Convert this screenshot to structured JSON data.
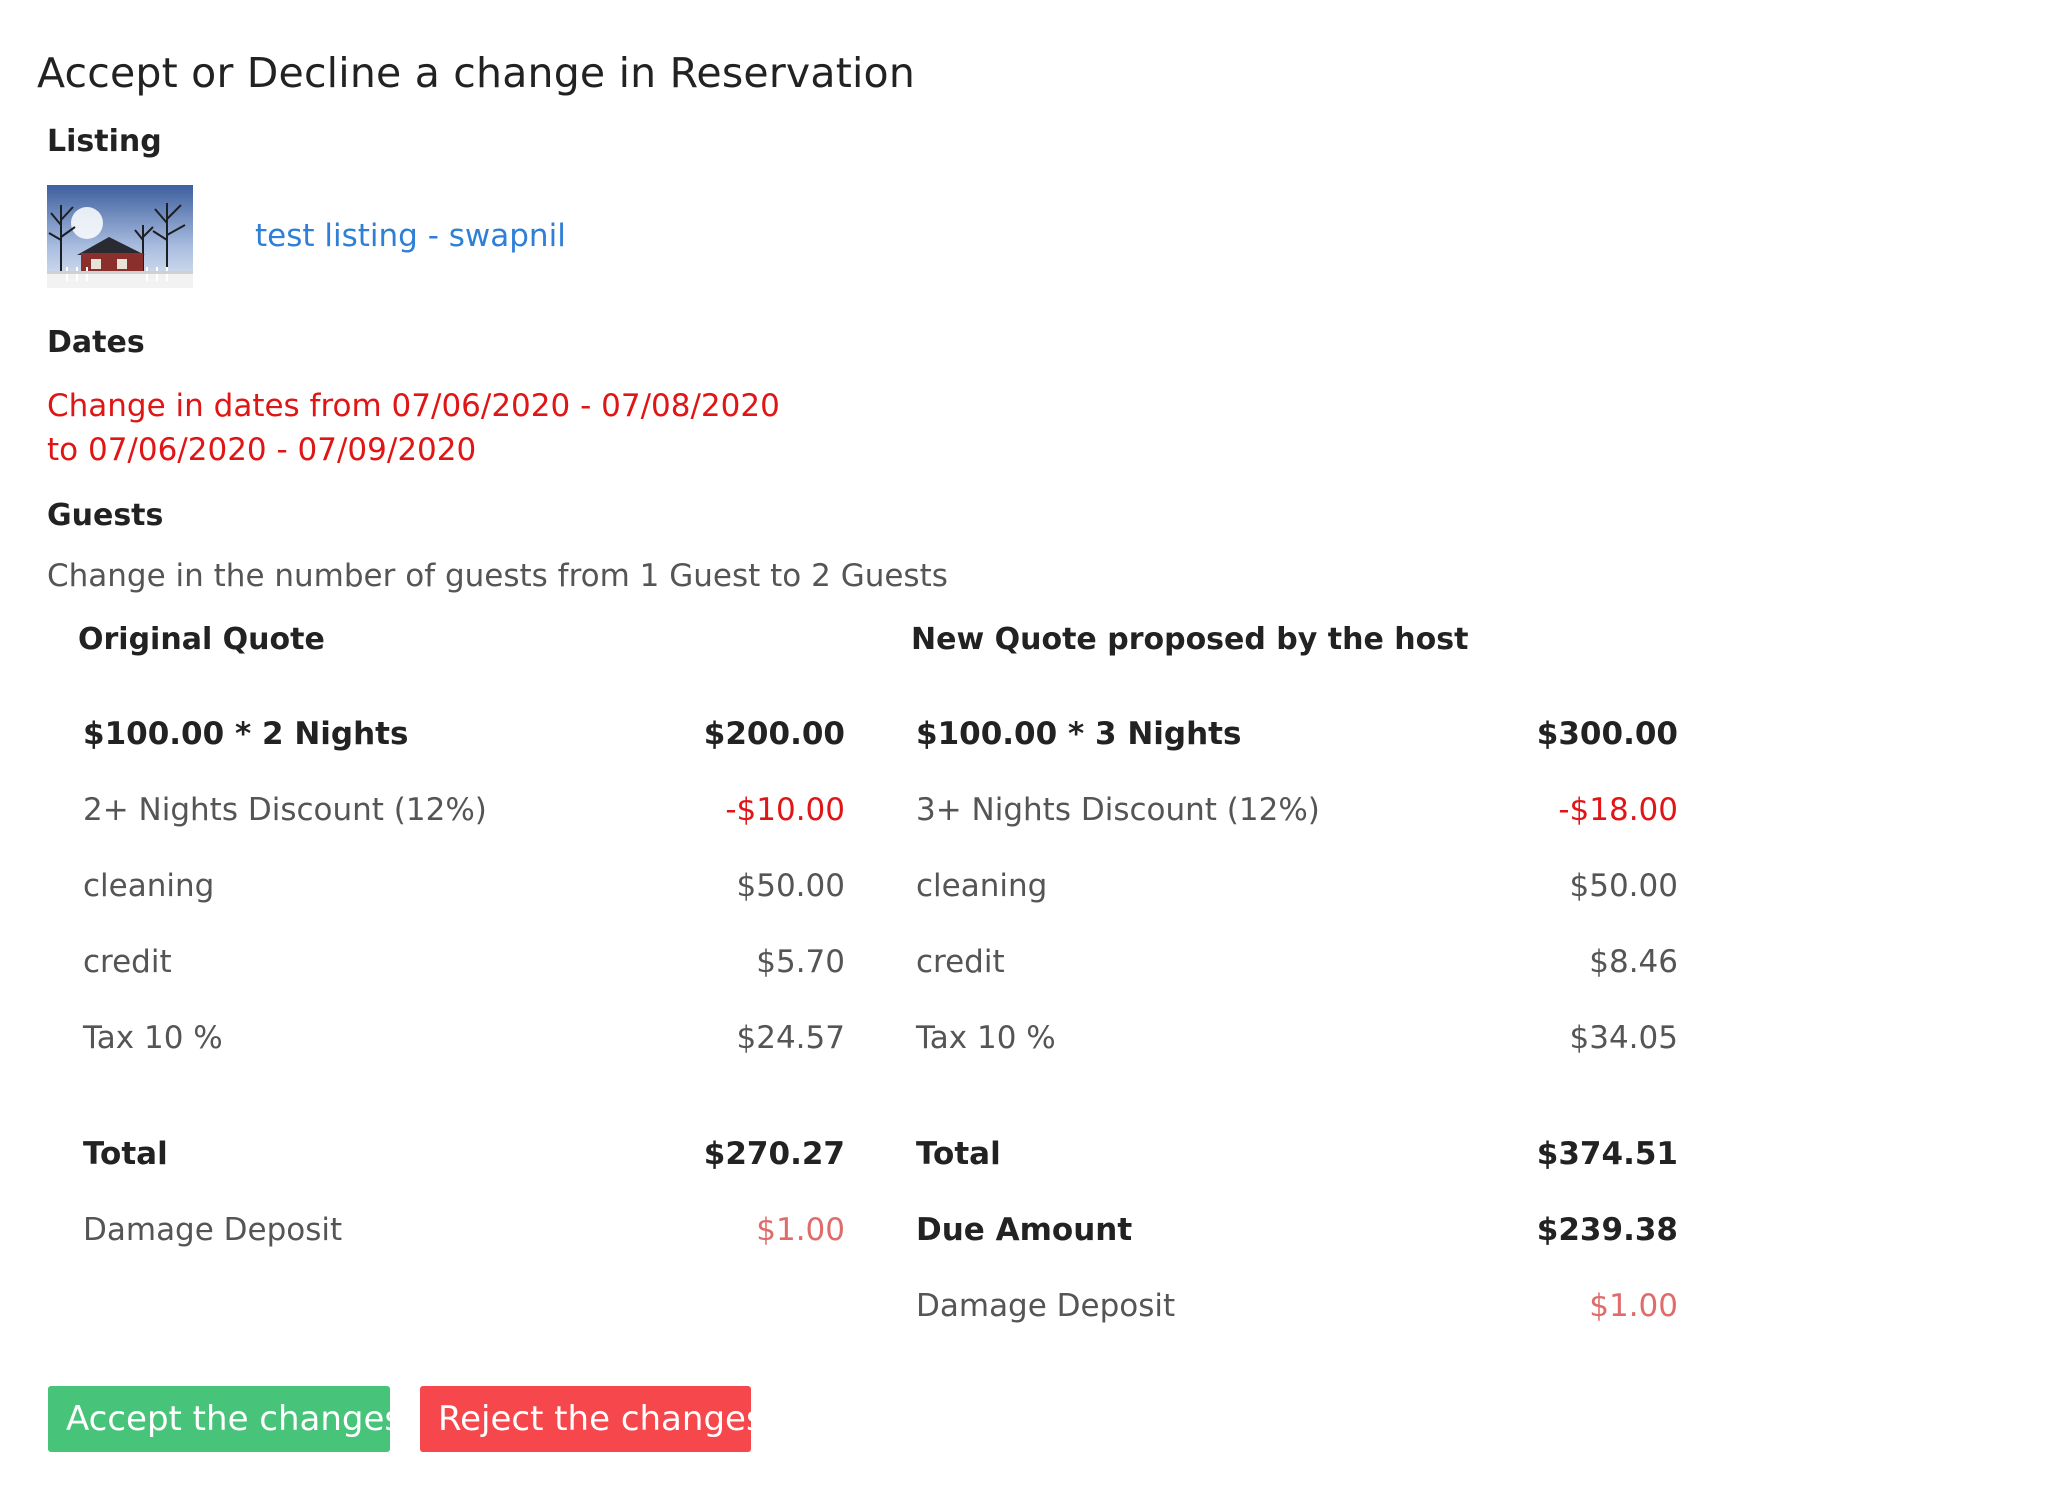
{
  "page": {
    "title": "Accept or Decline a change in Reservation"
  },
  "listing": {
    "label": "Listing",
    "link_text": "test listing - swapnil"
  },
  "dates": {
    "label": "Dates",
    "change_text": "Change in dates from 07/06/2020 - 07/08/2020 to 07/06/2020 - 07/09/2020"
  },
  "guests": {
    "label": "Guests",
    "change_text": "Change in the number of guests from 1 Guest to 2 Guests"
  },
  "original_quote": {
    "heading": "Original Quote",
    "nights": {
      "label": "$100.00 * 2 Nights",
      "amount": "$200.00"
    },
    "discount": {
      "label": "2+ Nights Discount (12%)",
      "amount": "-$10.00"
    },
    "cleaning": {
      "label": "cleaning",
      "amount": "$50.00"
    },
    "credit": {
      "label": "credit",
      "amount": "$5.70"
    },
    "tax": {
      "label": "Tax 10 %",
      "amount": "$24.57"
    },
    "total": {
      "label": "Total",
      "amount": "$270.27"
    },
    "damage_deposit": {
      "label": "Damage Deposit",
      "amount": "$1.00"
    }
  },
  "new_quote": {
    "heading": "New Quote proposed by the host",
    "nights": {
      "label": "$100.00 * 3 Nights",
      "amount": "$300.00"
    },
    "discount": {
      "label": "3+ Nights Discount (12%)",
      "amount": "-$18.00"
    },
    "cleaning": {
      "label": "cleaning",
      "amount": "$50.00"
    },
    "credit": {
      "label": "credit",
      "amount": "$8.46"
    },
    "tax": {
      "label": "Tax 10 %",
      "amount": "$34.05"
    },
    "total": {
      "label": "Total",
      "amount": "$374.51"
    },
    "due_amount": {
      "label": "Due Amount",
      "amount": "$239.38"
    },
    "damage_deposit": {
      "label": "Damage Deposit",
      "amount": "$1.00"
    }
  },
  "actions": {
    "accept_label": "Accept the changes",
    "reject_label": "Reject the changes"
  },
  "colors": {
    "accept_button": "#47c47a",
    "reject_button": "#f5474c",
    "link": "#2f7fd6",
    "alert_text": "#e01515",
    "deposit_text": "#e06b6b"
  }
}
